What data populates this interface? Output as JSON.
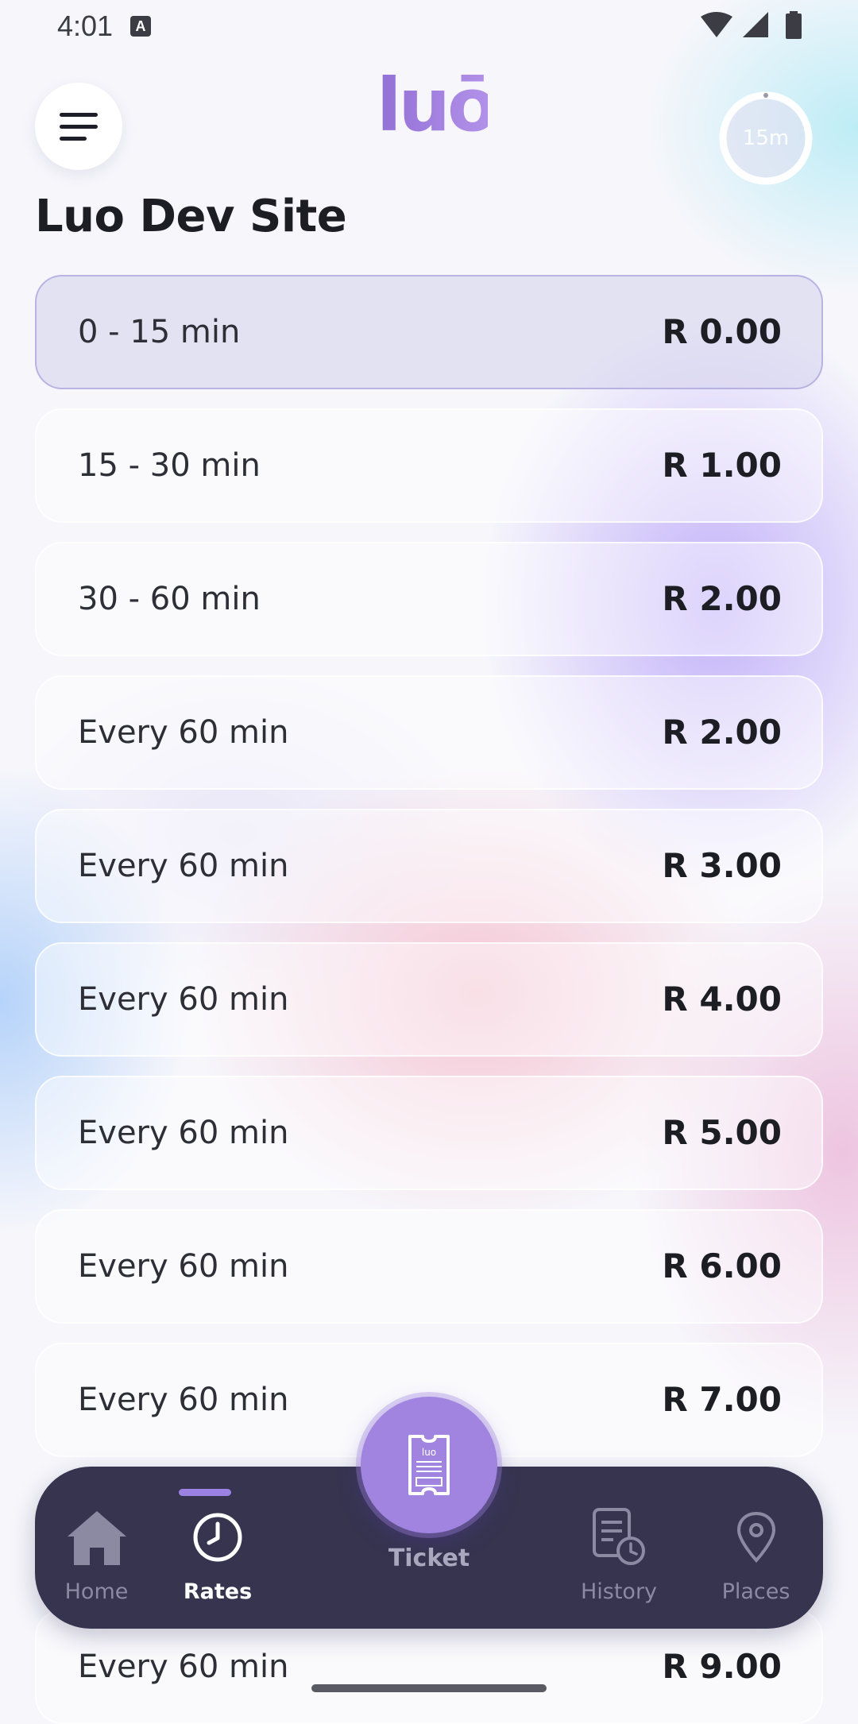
{
  "status_bar": {
    "time": "4:01",
    "notification_icon": "a-letter-icon",
    "icons": [
      "wifi-icon",
      "signal-icon",
      "battery-icon"
    ]
  },
  "header": {
    "logo_text": "luō",
    "menu_icon": "hamburger-icon",
    "timer_label": "15m",
    "timer_progress": 0.0
  },
  "site_title": "Luo Dev Site",
  "rates": [
    {
      "label": "0 - 15 min",
      "price": "R 0.00",
      "selected": true
    },
    {
      "label": "15 - 30 min",
      "price": "R 1.00",
      "selected": false
    },
    {
      "label": "30 - 60 min",
      "price": "R 2.00",
      "selected": false
    },
    {
      "label": "Every 60 min",
      "price": "R 2.00",
      "selected": false
    },
    {
      "label": "Every 60 min",
      "price": "R 3.00",
      "selected": false
    },
    {
      "label": "Every 60 min",
      "price": "R 4.00",
      "selected": false
    },
    {
      "label": "Every 60 min",
      "price": "R 5.00",
      "selected": false
    },
    {
      "label": "Every 60 min",
      "price": "R 6.00",
      "selected": false
    },
    {
      "label": "Every 60 min",
      "price": "R 7.00",
      "selected": false
    },
    {
      "label": "Every 60 min",
      "price": "R 9.00",
      "selected": false
    }
  ],
  "bottom_nav": {
    "items": [
      {
        "label": "Home",
        "icon": "home-icon",
        "active": false
      },
      {
        "label": "Rates",
        "icon": "clock-icon",
        "active": true
      },
      {
        "label": "History",
        "icon": "history-icon",
        "active": false
      },
      {
        "label": "Places",
        "icon": "location-pin-icon",
        "active": false
      }
    ],
    "ticket": {
      "label": "Ticket",
      "icon": "ticket-icon",
      "icon_text": "luo"
    }
  },
  "colors": {
    "accent": "#a084e0",
    "nav_background": "#36344f",
    "text_primary": "#1d1d24"
  }
}
